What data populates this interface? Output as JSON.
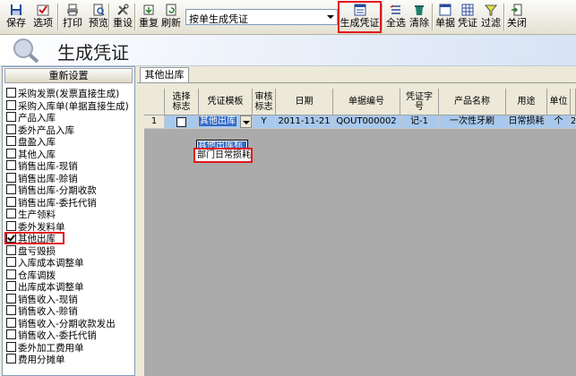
{
  "toolbar": {
    "buttons": [
      {
        "key": "save",
        "label": "保存",
        "icon": "save-icon"
      },
      {
        "key": "options",
        "label": "选项",
        "icon": "options-icon"
      },
      {
        "key": "print",
        "label": "打印",
        "icon": "print-icon"
      },
      {
        "key": "preview",
        "label": "预览",
        "icon": "preview-icon"
      },
      {
        "key": "reset",
        "label": "重设",
        "icon": "tools-icon"
      },
      {
        "key": "repeat",
        "label": "重复",
        "icon": "repeat-icon"
      },
      {
        "key": "refresh",
        "label": "刷新",
        "icon": "refresh-icon"
      },
      {
        "key": "generate",
        "label": "生成凭证",
        "icon": "generate-voucher-icon"
      },
      {
        "key": "selectall",
        "label": "全选",
        "icon": "select-all-icon"
      },
      {
        "key": "clear",
        "label": "清除",
        "icon": "clear-icon"
      },
      {
        "key": "doc",
        "label": "单据",
        "icon": "document-icon"
      },
      {
        "key": "voucher",
        "label": "凭证",
        "icon": "voucher-icon"
      },
      {
        "key": "filter",
        "label": "过滤",
        "icon": "filter-icon"
      },
      {
        "key": "close",
        "label": "关闭",
        "icon": "close-icon"
      }
    ],
    "mode_select": {
      "value": "按单生成凭证"
    }
  },
  "header": {
    "title": "生成凭证"
  },
  "sidebar": {
    "reset_label": "重新设置",
    "items": [
      {
        "label": "采购发票(发票直接生成)",
        "checked": false
      },
      {
        "label": "采购入库单(单据直接生成)",
        "checked": false
      },
      {
        "label": "产品入库",
        "checked": false
      },
      {
        "label": "委外产品入库",
        "checked": false
      },
      {
        "label": "盘盈入库",
        "checked": false
      },
      {
        "label": "其他入库",
        "checked": false
      },
      {
        "label": "销售出库-现销",
        "checked": false
      },
      {
        "label": "销售出库-赊销",
        "checked": false
      },
      {
        "label": "销售出库-分期收款",
        "checked": false
      },
      {
        "label": "销售出库-委托代销",
        "checked": false
      },
      {
        "label": "生产领料",
        "checked": false
      },
      {
        "label": "委外发料单",
        "checked": false
      },
      {
        "label": "其他出库",
        "checked": true
      },
      {
        "label": "盘亏毁损",
        "checked": false
      },
      {
        "label": "入库成本调整单",
        "checked": false
      },
      {
        "label": "仓库调拨",
        "checked": false
      },
      {
        "label": "出库成本调整单",
        "checked": false
      },
      {
        "label": "销售收入-现销",
        "checked": false
      },
      {
        "label": "销售收入-赊销",
        "checked": false
      },
      {
        "label": "销售收入-分期收款发出",
        "checked": false
      },
      {
        "label": "销售收入-委托代销",
        "checked": false
      },
      {
        "label": "委外加工费用单",
        "checked": false
      },
      {
        "label": "费用分摊单",
        "checked": false
      }
    ]
  },
  "tab": {
    "label": "其他出库"
  },
  "grid": {
    "headers": [
      "",
      "选择\n标志",
      "凭证模板",
      "审核\n标志",
      "日期",
      "单据编号",
      "凭证字\n号",
      "产品名称",
      "用途",
      "单位",
      ""
    ],
    "row": {
      "no": "1",
      "template": "其他出库",
      "audit": "Y",
      "date": "2011-11-21",
      "docno": "QOUT000002",
      "vno": "记-1",
      "product": "一次性牙刷",
      "usage": "日常损耗",
      "unit": "个",
      "extra": "2"
    }
  },
  "dropdown": {
    "options": [
      "其他出库标",
      "部门日常损耗"
    ]
  },
  "colors": {
    "highlight": "#e0191f",
    "selection": "#316ac5"
  }
}
